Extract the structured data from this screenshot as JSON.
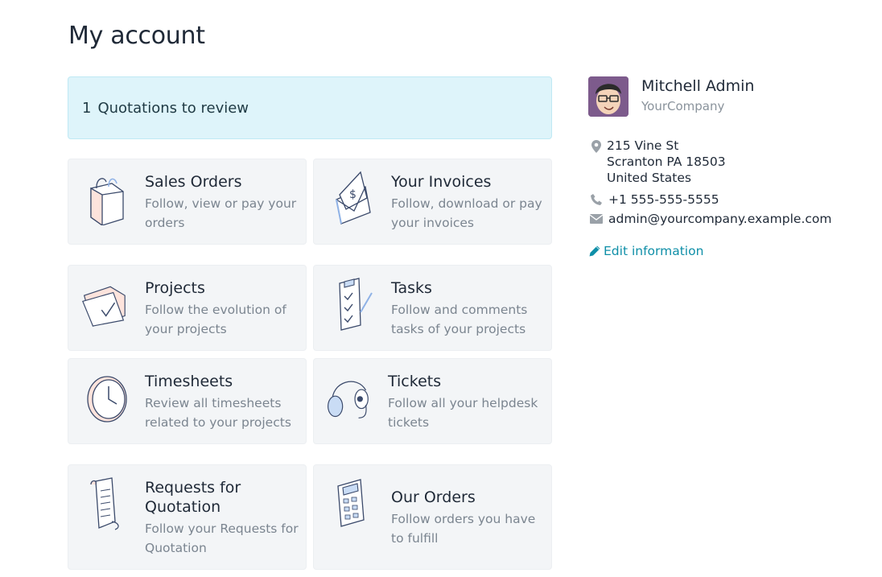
{
  "page": {
    "title": "My account"
  },
  "alert": {
    "count": "1",
    "text": "Quotations to review"
  },
  "cards": [
    {
      "title": "Sales Orders",
      "desc1": "Follow, view or pay your",
      "desc2": "orders",
      "icon": "shopping-bag-icon"
    },
    {
      "title": "Your Invoices",
      "desc1": "Follow, download or pay",
      "desc2": "your invoices",
      "icon": "invoice-envelope-icon"
    },
    {
      "title": "Projects",
      "desc1": "Follow the evolution of",
      "desc2": "your projects",
      "icon": "project-folder-icon"
    },
    {
      "title": "Tasks",
      "desc1": "Follow and comments",
      "desc2": "tasks of your projects",
      "icon": "task-checklist-icon"
    },
    {
      "title": "Timesheets",
      "desc1": "Review all timesheets",
      "desc2": "related to your projects",
      "icon": "clock-icon"
    },
    {
      "title": "Tickets",
      "desc1": "Follow all your helpdesk",
      "desc2": "tickets",
      "icon": "headset-icon"
    },
    {
      "title1": "Requests for",
      "title2": "Quotation",
      "desc1": "Follow your Requests for",
      "desc2": "Quotation",
      "icon": "scroll-icon"
    },
    {
      "title": "Our Orders",
      "desc1": "Follow orders you have",
      "desc2": "to fulfill",
      "icon": "calculator-icon"
    }
  ],
  "profile": {
    "name": "Mitchell Admin",
    "company": "YourCompany",
    "address1": "215 Vine St",
    "address2": "Scranton PA 18503",
    "address3": "United States",
    "phone": "+1 555-555-5555",
    "email": "admin@yourcompany.example.com",
    "edit_label": "Edit information"
  },
  "colors": {
    "accent": "#0f8fa8",
    "alert_bg": "#def4fa",
    "card_bg": "#f3f5f7"
  }
}
